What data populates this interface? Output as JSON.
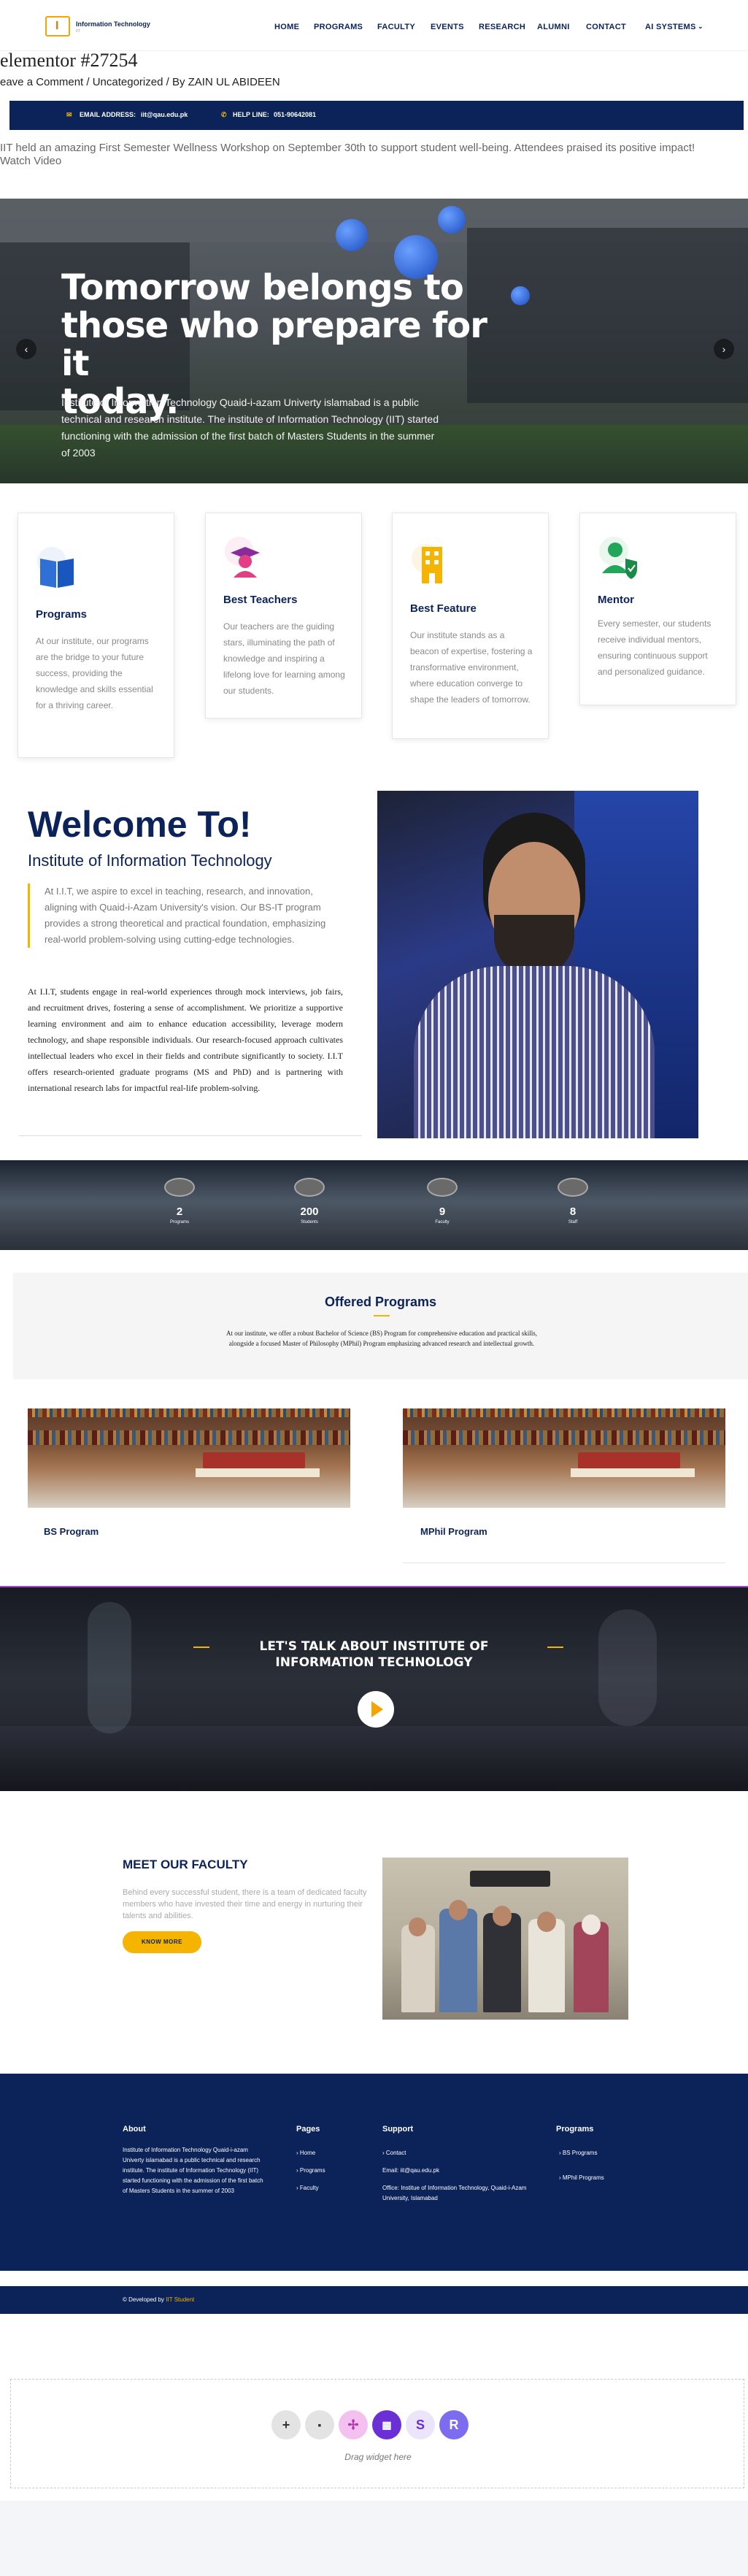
{
  "header": {
    "logo_text": "Information Technology",
    "logo_sub": "IIT",
    "nav": [
      "HOME",
      "PROGRAMS",
      "FACULTY",
      "EVENTS",
      "RESEARCH",
      "ALUMNI",
      "CONTACT",
      "AI SYSTEMS"
    ]
  },
  "post": {
    "title": "elementor #27254",
    "meta": "eave a Comment / Uncategorized / By ZAIN UL ABIDEEN"
  },
  "contact_bar": {
    "email_label": "EMAIL ADDRESS:",
    "email": "iit@qau.edu.pk",
    "help_label": "HELP LINE:",
    "phone": "051-90642081"
  },
  "announcement": {
    "text": "IIT held an amazing First Semester Wellness Workshop on September 30th to support student well-being. Attendees praised its positive impact!",
    "link": "Watch Video"
  },
  "hero": {
    "title_line1": "Tomorrow belongs to",
    "title_line2": "those who prepare for it",
    "title_line3": "today.",
    "text": "Institute of Information Technology Quaid-i-azam Univerty islamabad is a public technical and research institute. The institute of Information Technology (IIT) started functioning with the admission of the first batch of Masters Students in the summer of 2003",
    "prev": "‹",
    "next": "›"
  },
  "features": [
    {
      "title": "Programs",
      "text": "At our institute, our programs are the bridge to your future success, providing the knowledge and skills essential for a thriving career."
    },
    {
      "title": "Best Teachers",
      "text": "Our teachers are the guiding stars, illuminating the path of knowledge and inspiring a lifelong love for learning among our students."
    },
    {
      "title": "Best Feature",
      "text": "Our institute stands as a beacon of expertise, fostering a transformative environment, where education converge to shape the leaders of tomorrow."
    },
    {
      "title": "Mentor",
      "text": "Every semester, our students receive individual mentors, ensuring continuous support and personalized guidance."
    }
  ],
  "welcome": {
    "title": "Welcome To!",
    "subtitle": "Institute of Information Technology",
    "quote": "At I.I.T, we aspire to excel in teaching, research, and innovation, aligning with Quaid-i-Azam University's vision. Our BS-IT program provides a strong theoretical and practical foundation, emphasizing real-world problem-solving using cutting-edge technologies.",
    "body": "At I.I.T, students engage in real-world experiences through mock interviews, job fairs, and recruitment drives, fostering a sense of accomplishment. We prioritize a supportive learning environment and aim to enhance education accessibility, leverage modern technology, and shape responsible individuals. Our research-focused approach cultivates intellectual leaders who excel in their fields and contribute significantly to society. I.I.T offers research-oriented graduate programs (MS and PhD) and is partnering with international research labs for impactful real-life problem-solving."
  },
  "stats": [
    {
      "value": "2",
      "label": "Programs"
    },
    {
      "value": "200",
      "label": "Students"
    },
    {
      "value": "9",
      "label": "Faculty"
    },
    {
      "value": "8",
      "label": "Staff"
    }
  ],
  "offered": {
    "title": "Offered Programs",
    "text": "At our institute, we offer a robust Bachelor of Science (BS) Program for comprehensive education and practical skills, alongside a focused Master of Philosophy (MPhil) Program emphasizing advanced research and intellectual growth.",
    "programs": [
      "BS Program",
      "MPhil Program"
    ]
  },
  "video": {
    "title": "LET'S TALK ABOUT INSTITUTE OF INFORMATION TECHNOLOGY"
  },
  "faculty": {
    "title": "MEET OUR FACULTY",
    "text": "Behind every successful student, there is a team of dedicated faculty members who have invested their time and energy in nurturing their talents and abilities.",
    "button": "KNOW MORE"
  },
  "footer": {
    "about_head": "About",
    "about_text": "Institute of Information Technology Quaid-i-azam Univerty islamabad is a public technical and research institute. The institute of Information Technology (IIT) started functioning with the admission of the first batch of Masters Students in the summer of 2003",
    "pages_head": "Pages",
    "pages": [
      "Home",
      "Programs",
      "Faculty"
    ],
    "support_head": "Support",
    "support_contact": "Contact",
    "support_email": "Email: iit@qau.edu.pk",
    "support_office": "Office: Institue of Information Technology, Quaid-i-Azam University, Islamabad",
    "programs_head": "Programs",
    "programs": [
      "BS Programs",
      "MPhil Programs"
    ],
    "credit_prefix": "© Developed by",
    "credit_name": "IIT Student"
  },
  "widget": {
    "drag_text": "Drag widget here",
    "icons": [
      "+",
      "▪",
      "✢",
      "▦",
      "S",
      "R"
    ]
  },
  "colors": {
    "navy": "#0b2358",
    "accent": "#f5b400"
  }
}
